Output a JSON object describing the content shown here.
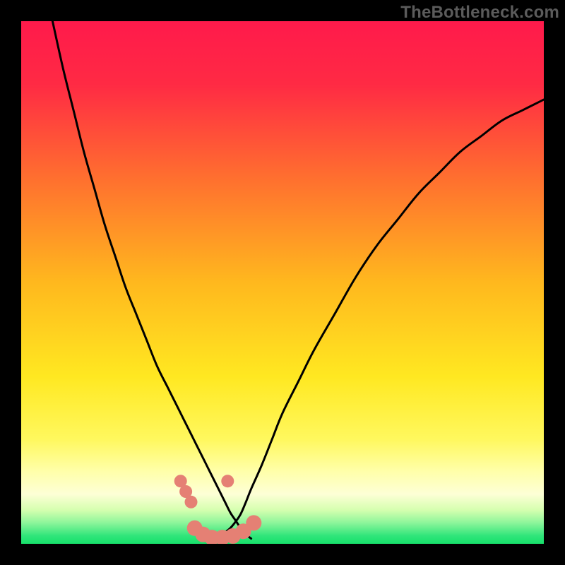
{
  "watermark": "TheBottleneck.com",
  "chart_data": {
    "type": "line",
    "title": "",
    "xlabel": "",
    "ylabel": "",
    "xlim": [
      0,
      100
    ],
    "ylim": [
      0,
      100
    ],
    "grid": false,
    "legend": false,
    "background_gradient": {
      "stops": [
        {
          "offset": 0.0,
          "color": "#ff1a4b"
        },
        {
          "offset": 0.12,
          "color": "#ff2a44"
        },
        {
          "offset": 0.3,
          "color": "#ff6f2f"
        },
        {
          "offset": 0.5,
          "color": "#ffb81e"
        },
        {
          "offset": 0.68,
          "color": "#ffe821"
        },
        {
          "offset": 0.8,
          "color": "#fff85e"
        },
        {
          "offset": 0.86,
          "color": "#ffffa8"
        },
        {
          "offset": 0.905,
          "color": "#fdffd6"
        },
        {
          "offset": 0.935,
          "color": "#d6ffb0"
        },
        {
          "offset": 0.96,
          "color": "#8cf59a"
        },
        {
          "offset": 0.985,
          "color": "#2fe57a"
        },
        {
          "offset": 1.0,
          "color": "#17e06a"
        }
      ]
    },
    "series": [
      {
        "name": "left-curve",
        "x": [
          6,
          8,
          10,
          12,
          14,
          16,
          18,
          20,
          22,
          24,
          26,
          28,
          29,
          30,
          31,
          32,
          33,
          34,
          35,
          36,
          37,
          38,
          39,
          40,
          41,
          42,
          43,
          44
        ],
        "y": [
          100,
          91,
          83,
          75,
          68,
          61,
          55,
          49,
          44,
          39,
          34,
          30,
          28,
          26,
          24,
          22,
          20,
          18,
          16,
          14,
          12,
          10,
          8,
          6,
          4.5,
          3,
          1.8,
          1.0
        ]
      },
      {
        "name": "right-curve",
        "x": [
          36,
          37,
          38,
          39,
          40,
          41,
          42,
          43,
          44,
          46,
          48,
          50,
          53,
          56,
          60,
          64,
          68,
          72,
          76,
          80,
          84,
          88,
          92,
          96,
          100
        ],
        "y": [
          1.0,
          1.2,
          1.6,
          2.2,
          3.0,
          4.2,
          5.7,
          8.0,
          10.5,
          15,
          20,
          25,
          31,
          37,
          44,
          51,
          57,
          62,
          67,
          71,
          75,
          78,
          81,
          83,
          85
        ]
      }
    ],
    "markers": {
      "name": "bottom-dots",
      "color": "#e58074",
      "radius_large": 11,
      "radius_small": 9,
      "points": [
        {
          "x": 30.5,
          "y": 12.0,
          "r": "small"
        },
        {
          "x": 31.5,
          "y": 10.0,
          "r": "small"
        },
        {
          "x": 32.5,
          "y": 8.0,
          "r": "small"
        },
        {
          "x": 33.2,
          "y": 3.0,
          "r": "large"
        },
        {
          "x": 34.8,
          "y": 1.8,
          "r": "large"
        },
        {
          "x": 36.5,
          "y": 1.2,
          "r": "large"
        },
        {
          "x": 38.5,
          "y": 1.2,
          "r": "large"
        },
        {
          "x": 40.5,
          "y": 1.5,
          "r": "large"
        },
        {
          "x": 42.5,
          "y": 2.4,
          "r": "large"
        },
        {
          "x": 44.5,
          "y": 4.0,
          "r": "large"
        },
        {
          "x": 39.5,
          "y": 12.0,
          "r": "small"
        }
      ]
    }
  }
}
